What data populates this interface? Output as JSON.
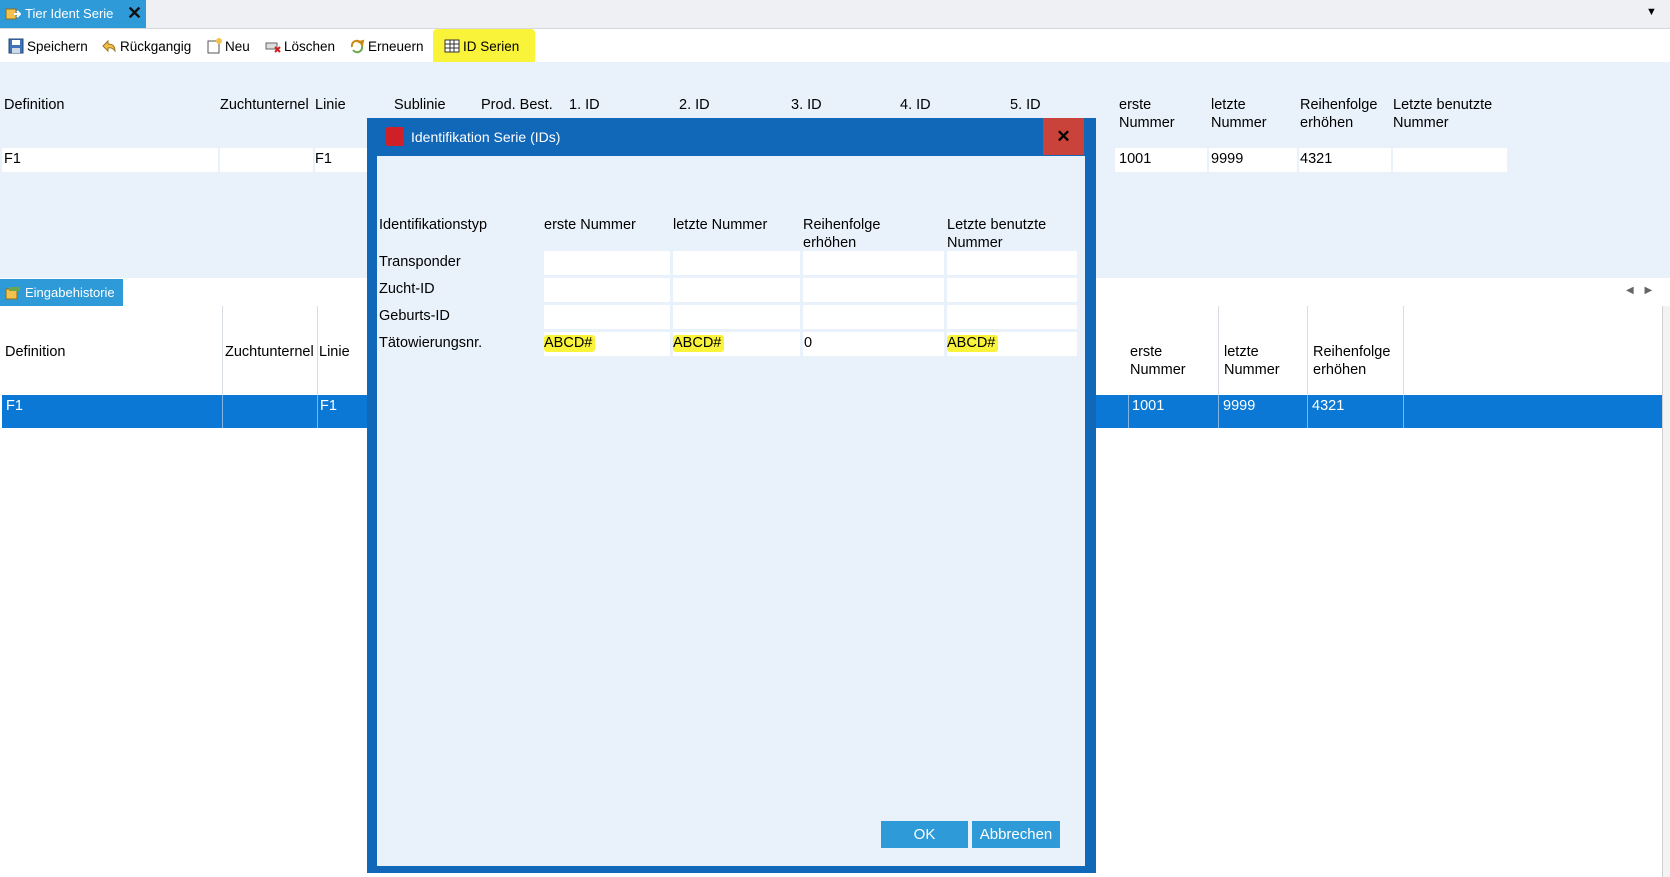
{
  "tab": {
    "title": "Tier Ident Serie",
    "close": "✕"
  },
  "tab_menu": "▼",
  "toolbar": {
    "speichern": "Speichern",
    "rueckgaengig": "Rückgangig",
    "neu": "Neu",
    "loeschen": "Löschen",
    "erneuern": "Erneuern",
    "id_serien": "ID Serien",
    "highlight_color": "#f9f33a"
  },
  "upper_grid": {
    "headers": {
      "definition": "Definition",
      "zuchtunternel": "Zuchtunternel",
      "linie": "Linie",
      "sublinie": "Sublinie",
      "prod_best": "Prod. Best.",
      "id1": "1. ID",
      "id2": "2. ID",
      "id3": "3. ID",
      "id4": "4. ID",
      "id5": "5. ID",
      "erste_nummer_1": "erste",
      "erste_nummer_2": "Nummer",
      "letzte_nummer_1": "letzte",
      "letzte_nummer_2": "Nummer",
      "reihenfolge_1": "Reihenfolge",
      "reihenfolge_2": "erhöhen",
      "letzte_benutzte_1": "Letzte benutzte",
      "letzte_benutzte_2": "Nummer"
    },
    "row": {
      "definition": "F1",
      "linie": "F1",
      "erste_nummer": "1001",
      "letzte_nummer": "9999",
      "reihenfolge": "4321",
      "letzte_benutzte": ""
    }
  },
  "history_tab": {
    "title": "Eingabehistorie"
  },
  "scroll_arrows": "◀ ▶",
  "lower_grid": {
    "headers": {
      "definition": "Definition",
      "zuchtunternel": "Zuchtunternel",
      "linie": "Linie",
      "erste_nummer_1": "erste",
      "erste_nummer_2": "Nummer",
      "letzte_nummer_1": "letzte",
      "letzte_nummer_2": "Nummer",
      "reihenfolge_1": "Reihenfolge",
      "reihenfolge_2": "erhöhen"
    },
    "row": {
      "definition": "F1",
      "linie": "F1",
      "erste_nummer": "1001",
      "letzte_nummer": "9999",
      "reihenfolge": "4321"
    },
    "selection_color": "#0a78d4"
  },
  "dialog": {
    "title": "Identifikation Serie  (IDs)",
    "close": "✕",
    "headers": {
      "identifikationstyp": "Identifikationstyp",
      "erste_nummer": "erste Nummer",
      "letzte_nummer": "letzte Nummer",
      "reihenfolge_1": "Reihenfolge",
      "reihenfolge_2": "erhöhen",
      "letzte_benutzte_1": "Letzte benutzte",
      "letzte_benutzte_2": "Nummer"
    },
    "rows": [
      {
        "typ": "Transponder",
        "erste": "",
        "letzte": "",
        "reihenfolge": "",
        "letzte_benutzte": ""
      },
      {
        "typ": "Zucht-ID",
        "erste": "",
        "letzte": "",
        "reihenfolge": "",
        "letzte_benutzte": ""
      },
      {
        "typ": "Geburts-ID",
        "erste": "",
        "letzte": "",
        "reihenfolge": "",
        "letzte_benutzte": ""
      },
      {
        "typ": "Tätowierungsnr.",
        "erste": "ABCD#",
        "letzte": "ABCD#",
        "reihenfolge": "0",
        "letzte_benutzte": "ABCD#"
      }
    ],
    "ok": "OK",
    "abbrechen": "Abbrechen",
    "title_bar_color": "#1167b8",
    "close_color": "#c9433b"
  }
}
